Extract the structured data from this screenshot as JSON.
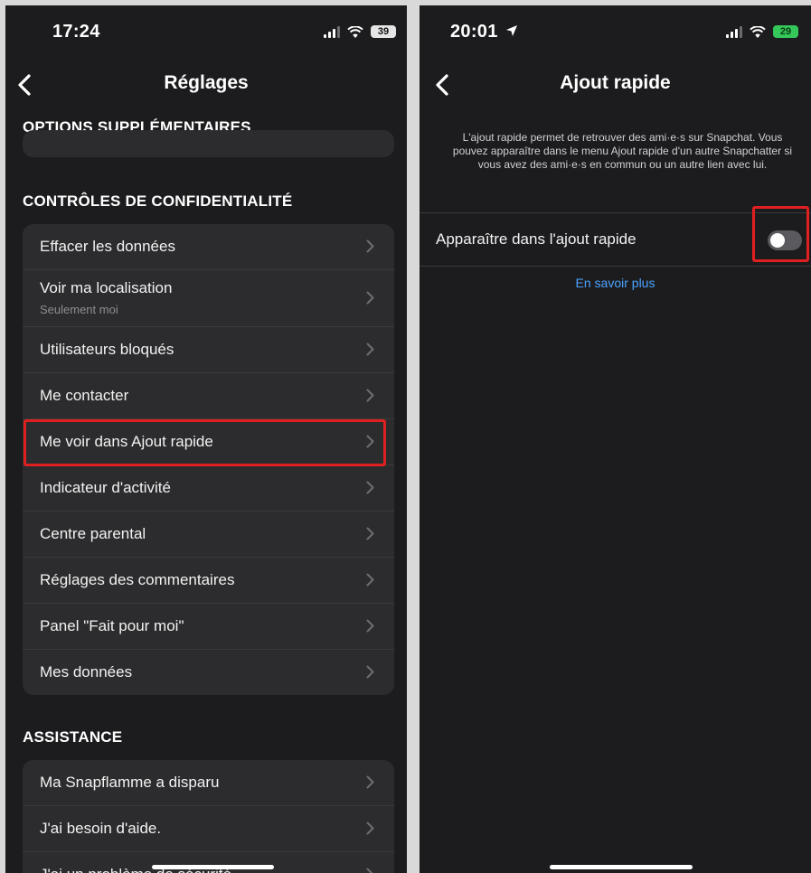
{
  "left_screen": {
    "status": {
      "time": "17:24",
      "battery": "39"
    },
    "nav": {
      "title": "Réglages"
    },
    "sections": {
      "extra_options": "OPTIONS SUPPLÉMENTAIRES",
      "privacy_controls": "CONTRÔLES DE CONFIDENTIALITÉ",
      "support": "ASSISTANCE"
    },
    "privacy_items": [
      {
        "label": "Effacer les données"
      },
      {
        "label": "Voir ma localisation",
        "sublabel": "Seulement moi"
      },
      {
        "label": "Utilisateurs bloqués"
      },
      {
        "label": "Me contacter"
      },
      {
        "label": "Me voir dans Ajout rapide"
      },
      {
        "label": "Indicateur d'activité"
      },
      {
        "label": "Centre parental"
      },
      {
        "label": "Réglages des commentaires"
      },
      {
        "label": "Panel \"Fait pour moi\""
      },
      {
        "label": "Mes données"
      }
    ],
    "support_items": [
      {
        "label": "Ma Snapflamme a disparu"
      },
      {
        "label": "J'ai besoin d'aide."
      },
      {
        "label": "J'ai un problème de sécurité"
      }
    ]
  },
  "right_screen": {
    "status": {
      "time": "20:01",
      "battery": "29"
    },
    "nav": {
      "title": "Ajout rapide"
    },
    "description": "L'ajout rapide permet de retrouver des ami·e·s sur Snapchat. Vous pouvez apparaître dans le menu Ajout rapide d'un autre Snapchatter si vous avez des ami·e·s en commun ou un autre lien avec lui.",
    "toggle": {
      "label": "Apparaître dans l'ajout rapide",
      "enabled": false
    },
    "link": "En savoir plus"
  },
  "colors": {
    "background": "#1c1c1e",
    "card": "#2c2c2e",
    "highlight": "#e02020",
    "link": "#4aa3ff",
    "charging": "#34c759"
  }
}
